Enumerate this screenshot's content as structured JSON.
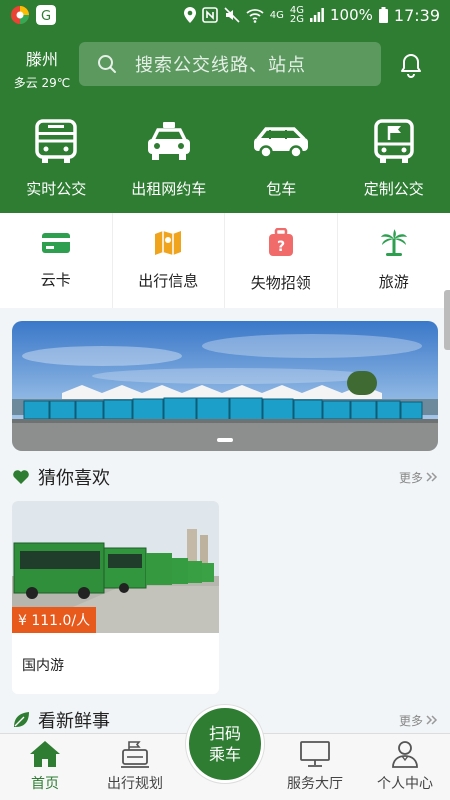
{
  "status_bar": {
    "network_top": "4G",
    "network_bottom": "2G",
    "battery": "100%",
    "time": "17:39"
  },
  "header": {
    "city": "滕州",
    "weather": "多云 29℃",
    "search_placeholder": "搜索公交线路、站点"
  },
  "main_nav": [
    {
      "label": "实时公交",
      "icon": "bus-icon"
    },
    {
      "label": "出租网约车",
      "icon": "taxi-icon"
    },
    {
      "label": "包车",
      "icon": "car-icon"
    },
    {
      "label": "定制公交",
      "icon": "custom-bus-icon"
    }
  ],
  "sub_nav": [
    {
      "label": "云卡",
      "icon": "card-icon",
      "color": "#2e9e4f"
    },
    {
      "label": "出行信息",
      "icon": "map-icon",
      "color": "#f0a31c"
    },
    {
      "label": "失物招领",
      "icon": "luggage-icon",
      "color": "#f26b6b"
    },
    {
      "label": "旅游",
      "icon": "palm-icon",
      "color": "#2e9e4f"
    }
  ],
  "sections": {
    "guess": {
      "title": "猜你喜欢",
      "more": "更多"
    },
    "news": {
      "title": "看新鲜事",
      "more": "更多"
    }
  },
  "card": {
    "price": "¥ 111.0/人",
    "title": "国内游"
  },
  "bottom_tabs": [
    {
      "label": "首页",
      "icon": "home-icon",
      "active": true
    },
    {
      "label": "出行规划",
      "icon": "route-plan-icon",
      "active": false
    },
    {
      "label": "服务大厅",
      "icon": "service-hall-icon",
      "active": false
    },
    {
      "label": "个人中心",
      "icon": "profile-icon",
      "active": false
    }
  ],
  "scan_button": {
    "line1": "扫码",
    "line2": "乘车"
  },
  "colors": {
    "brand": "#2e7d32",
    "price": "#e8591c"
  }
}
